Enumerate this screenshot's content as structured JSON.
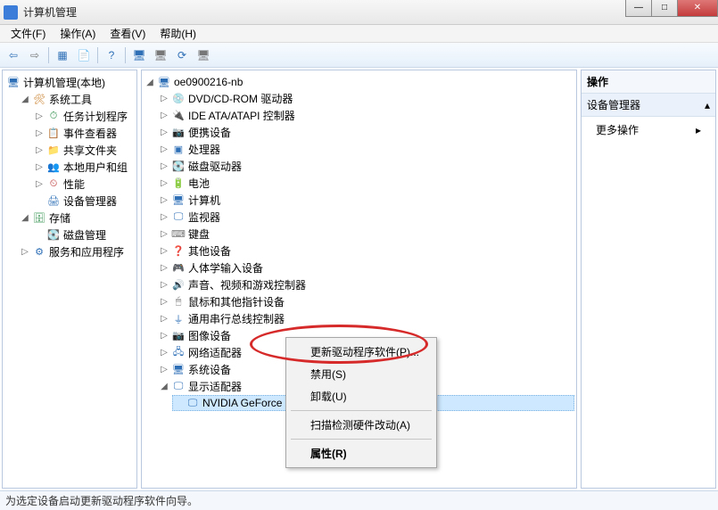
{
  "window": {
    "title": "计算机管理"
  },
  "win_btns": {
    "min": "—",
    "max": "□",
    "close": "✕"
  },
  "menu": {
    "file": "文件(F)",
    "action": "操作(A)",
    "view": "查看(V)",
    "help": "帮助(H)"
  },
  "left_tree": {
    "root": "计算机管理(本地)",
    "system_tools": "系统工具",
    "task_scheduler": "任务计划程序",
    "event_viewer": "事件查看器",
    "shared_folders": "共享文件夹",
    "local_users": "本地用户和组",
    "performance": "性能",
    "device_manager": "设备管理器",
    "storage": "存储",
    "disk_mgmt": "磁盘管理",
    "services_apps": "服务和应用程序"
  },
  "center_tree": {
    "root": "oe0900216-nb",
    "dvd": "DVD/CD-ROM 驱动器",
    "ide": "IDE ATA/ATAPI 控制器",
    "portable": "便携设备",
    "processor": "处理器",
    "disk": "磁盘驱动器",
    "battery": "电池",
    "computer": "计算机",
    "monitor": "监视器",
    "keyboard": "键盘",
    "other": "其他设备",
    "hid": "人体学输入设备",
    "sound": "声音、视频和游戏控制器",
    "mouse": "鼠标和其他指针设备",
    "usb": "通用串行总线控制器",
    "image": "图像设备",
    "network": "网络适配器",
    "system": "系统设备",
    "display": "显示适配器",
    "gpu": "NVIDIA GeForce G"
  },
  "context_menu": {
    "update": "更新驱动程序软件(P)...",
    "disable": "禁用(S)",
    "uninstall": "卸载(U)",
    "scan": "扫描检测硬件改动(A)",
    "properties": "属性(R)"
  },
  "right_panel": {
    "header": "操作",
    "section": "设备管理器",
    "section_arrow": "▴",
    "more_actions": "更多操作",
    "more_arrow": "▸"
  },
  "statusbar": {
    "text": "为选定设备启动更新驱动程序软件向导。"
  },
  "glyphs": {
    "caret_open": "◢",
    "caret_closed": "▷",
    "back": "⇦",
    "fwd": "⇨",
    "help": "?",
    "grid": "▦",
    "screen": "🖥",
    "refresh": "⟳",
    "doc": "📄"
  }
}
